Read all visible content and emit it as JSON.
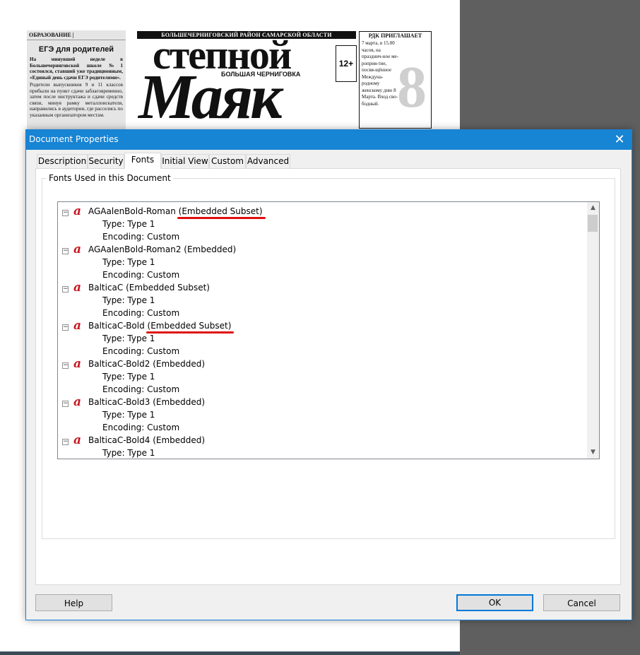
{
  "background": {
    "newspaper": {
      "section": "ОБРАЗОВАНИЕ |",
      "headline": "ЕГЭ для родителей",
      "lead": "На минувшей неделе в Большечерниговской школе №1 состоялся, ставший уже традиционным, «Единый день сдачи ЕГЭ родителями».",
      "body": "Родители выпускников 9 и 11 классов прибыли на пункт сдачи заблаговременно, затем после инструктажа и сдачи средств связи, минуя рамку металлоискателя, направились в аудитории, где расселись по указанным организатором местам.",
      "banner": "БОЛЬШЕЧЕРНИГОВСКИЙ РАЙОН САМАРСКОЙ ОБЛАСТИ",
      "title_line1": "степной",
      "subtitle": "БОЛЬШАЯ ЧЕРНИГОВКА",
      "title_line2": "Маяк",
      "age_rating": "12+",
      "ad_title": "РДК ПРИГЛАШАЕТ",
      "ad_text": "7 марта, в 15.00 часов, на празднич-ное ме-роприя-тие, посвя-щённое Междуна-родному женскому дню 8 Марта. Вход сво-бодный.",
      "ad_numeral": "8"
    }
  },
  "dialog": {
    "title": "Document Properties",
    "close_glyph": "✕",
    "tabs": [
      "Description",
      "Security",
      "Fonts",
      "Initial View",
      "Custom",
      "Advanced"
    ],
    "active_tab": "Fonts",
    "group_label": "Fonts Used in this Document",
    "fonts": [
      {
        "name": "AGAalenBold-Roman",
        "status": "(Embedded Subset)",
        "type": "Type: Type 1",
        "encoding": "Encoding: Custom",
        "highlighted": true
      },
      {
        "name": "AGAalenBold-Roman2",
        "status": "(Embedded)",
        "type": "Type: Type 1",
        "encoding": "Encoding: Custom",
        "highlighted": false
      },
      {
        "name": "BalticaC",
        "status": "(Embedded Subset)",
        "type": "Type: Type 1",
        "encoding": "Encoding: Custom",
        "highlighted": false
      },
      {
        "name": "BalticaC-Bold",
        "status": "(Embedded Subset)",
        "type": "Type: Type 1",
        "encoding": "Encoding: Custom",
        "highlighted": true
      },
      {
        "name": "BalticaC-Bold2",
        "status": "(Embedded)",
        "type": "Type: Type 1",
        "encoding": "Encoding: Custom",
        "highlighted": false
      },
      {
        "name": "BalticaC-Bold3",
        "status": "(Embedded)",
        "type": "Type: Type 1",
        "encoding": "Encoding: Custom",
        "highlighted": false
      },
      {
        "name": "BalticaC-Bold4",
        "status": "(Embedded)",
        "type": "Type: Type 1",
        "encoding": "",
        "highlighted": false
      }
    ],
    "font_icon_glyph": "a",
    "toggle_glyph": "−",
    "scroll_up_glyph": "▲",
    "scroll_down_glyph": "▼",
    "help_label": "Help",
    "ok_label": "OK",
    "cancel_label": "Cancel",
    "colors": {
      "titlebar": "#1784d4",
      "font_icon": "#c8141e",
      "highlight_underline": "#e01010",
      "ok_border": "#0078d7"
    }
  }
}
